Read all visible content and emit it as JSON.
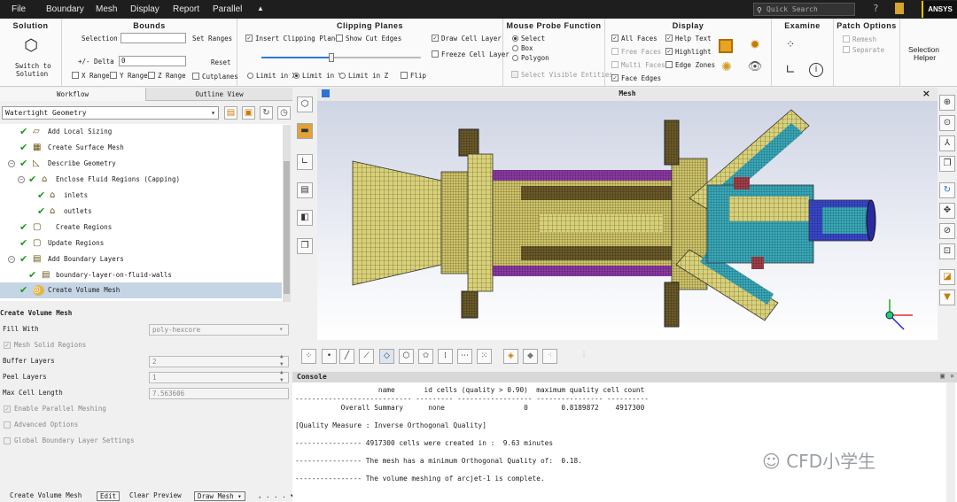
{
  "menu": [
    "File",
    "Boundary",
    "Mesh",
    "Display",
    "Report",
    "Parallel",
    "▲"
  ],
  "search_placeholder": "Quick Search",
  "brand": "ANSYS",
  "ribbon": {
    "solution": {
      "title": "Solution",
      "switch_label1": "Switch to",
      "switch_label2": "Solution"
    },
    "bounds": {
      "title": "Bounds",
      "selection_label": "Selection",
      "set_ranges": "Set Ranges",
      "delta_label": "+/- Delta",
      "delta_value": "0",
      "reset": "Reset",
      "x_range": "X Range",
      "y_range": "Y Range",
      "z_range": "Z Range",
      "cutplanes": "Cutplanes"
    },
    "clipping": {
      "title": "Clipping Planes",
      "insert": "Insert Clipping Planes",
      "show_cut": "Show Cut Edges",
      "draw_cell": "Draw Cell Layer",
      "freeze_cell": "Freeze Cell Layer",
      "limit_x": "Limit in X",
      "limit_y": "Limit in Y",
      "limit_z": "Limit in Z",
      "flip": "Flip"
    },
    "probe": {
      "title": "Mouse Probe Function",
      "select": "Select",
      "box": "Box",
      "polygon": "Polygon",
      "select_visible": "Select Visible Entities"
    },
    "display": {
      "title": "Display",
      "all_faces": "All Faces",
      "free_faces": "Free Faces",
      "multi_faces": "Multi Faces",
      "face_edges": "Face Edges",
      "help_text": "Help Text",
      "highlight": "Highlight",
      "edge_zones": "Edge Zones"
    },
    "examine": {
      "title": "Examine"
    },
    "patch": {
      "title": "Patch Options",
      "remesh": "Remesh",
      "separate": "Separate"
    },
    "sel_helper1": "Selection",
    "sel_helper2": "Helper"
  },
  "left": {
    "tabs": [
      "Workflow",
      "Outline View"
    ],
    "workflow_type": "Watertight Geometry",
    "tree": [
      {
        "label": "Add Local Sizing"
      },
      {
        "label": "Create Surface Mesh"
      },
      {
        "label": "Describe Geometry"
      },
      {
        "label": "Enclose Fluid Regions (Capping)"
      },
      {
        "label": "inlets"
      },
      {
        "label": "outlets"
      },
      {
        "label": "Create Regions"
      },
      {
        "label": "Update Regions"
      },
      {
        "label": "Add Boundary Layers"
      },
      {
        "label": "boundary-layer-on-fluid-walls"
      },
      {
        "label": "Create Volume Mesh"
      }
    ],
    "task": {
      "title": "Create Volume Mesh",
      "fill_with_label": "Fill With",
      "fill_with_value": "poly-hexcore",
      "mesh_solid": "Mesh Solid Regions",
      "buffer_label": "Buffer Layers",
      "buffer_value": "2",
      "peel_label": "Peel Layers",
      "peel_value": "1",
      "maxcell_label": "Max Cell Length",
      "maxcell_value": "7.563606",
      "parallel": "Enable Parallel Meshing",
      "advanced": "Advanced Options",
      "global_bl": "Global Boundary Layer Settings"
    },
    "buttons": [
      "Create Volume Mesh",
      "Edit",
      "Clear Preview",
      "Draw Mesh ▾",
      ", . . . ▾"
    ]
  },
  "graphics": {
    "title": "Mesh",
    "close": "×"
  },
  "console": {
    "title": "Console",
    "lines": [
      "                    name       id cells (quality > 0.90)  maximum quality cell count",
      "---------------------------- --------- ------------------ ---------------- ----------",
      "           Overall Summary      none                   0        0.8189872    4917300",
      "",
      "[Quality Measure : Inverse Orthogonal Quality]",
      "",
      "---------------- 4917300 cells were created in :  9.63 minutes",
      "",
      "---------------- The mesh has a minimum Orthogonal Quality of:  0.18.",
      "",
      "---------------- The volume meshing of arcjet-1 is complete."
    ]
  },
  "watermark": "CFD小学生",
  "colors": {
    "menubar": "#1e1e1e",
    "accent": "#f2c300",
    "selected": "#c5d5e6",
    "check": "#1e9a1e"
  }
}
